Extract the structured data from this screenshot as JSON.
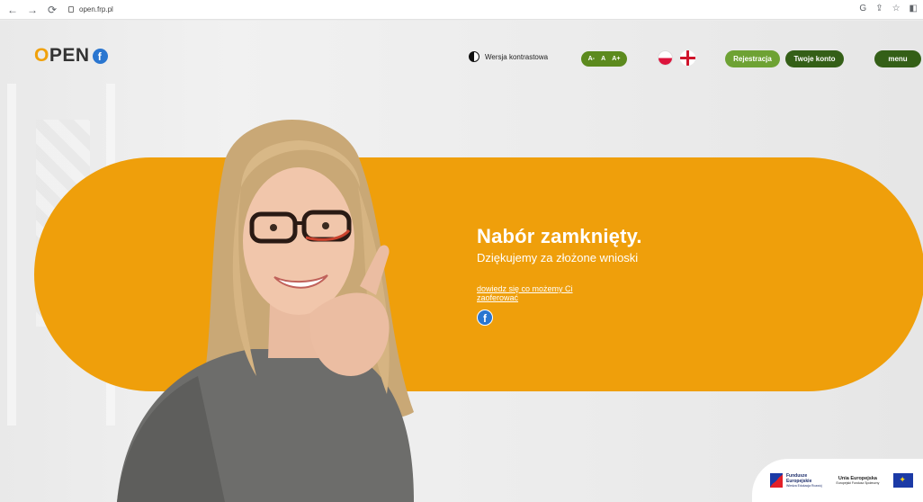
{
  "browser": {
    "url": "open.frp.pl"
  },
  "header": {
    "logo_text": "OPEN",
    "contrast_label": "Wersja kontrastowa",
    "font_sizes": [
      "A-",
      "A",
      "A+"
    ],
    "register_label": "Rejestracja",
    "account_label": "Twoje konto",
    "menu_label": "menu"
  },
  "hero": {
    "title": "Nabór zamknięty.",
    "subtitle": "Dziękujemy za złożone wnioski",
    "link_text": "dowiedz się co możemy Ci zaoferować"
  },
  "footer_logos": {
    "fe_line1": "Fundusze",
    "fe_line2": "Europejskie",
    "fe_line3": "Wiedza Edukacja Rozwój",
    "ue_line1": "Unia Europejska",
    "ue_line2": "Europejski Fundusz Społeczny"
  },
  "colors": {
    "accent_orange": "#ef9f0b",
    "green_light": "#6ea234",
    "green_dark": "#345f17"
  },
  "icons": [
    "back-icon",
    "forward-icon",
    "reload-icon",
    "lock-icon",
    "facebook-icon",
    "contrast-icon",
    "poland-flag-icon",
    "uk-flag-icon",
    "eu-flag-icon"
  ]
}
